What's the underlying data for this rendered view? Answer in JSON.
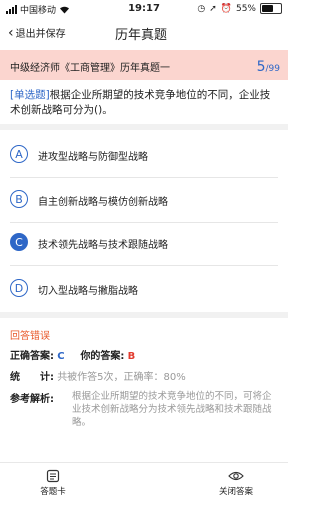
{
  "status": {
    "carrier": "中国移动",
    "time": "19:17",
    "battery": "55%"
  },
  "nav": {
    "back_label": "退出并保存",
    "title": "历年真题"
  },
  "exam": {
    "title": "中级经济师《工商管理》历年真题一",
    "current": "5",
    "total": "/99"
  },
  "question": {
    "type_label": "[单选题]",
    "text": "根据企业所期望的技术竞争地位的不同，企业技术创新战略可分为()。"
  },
  "options": [
    {
      "letter": "A",
      "text": "进攻型战略与防御型战略",
      "selected": false
    },
    {
      "letter": "B",
      "text": "自主创新战略与模仿创新战略",
      "selected": false
    },
    {
      "letter": "C",
      "text": "技术领先战略与技术跟随战略",
      "selected": true
    },
    {
      "letter": "D",
      "text": "切入型战略与撇脂战略",
      "selected": false
    }
  ],
  "result": {
    "title": "回答错误",
    "correct_label": "正确答案:",
    "correct_value": "C",
    "your_label": "你的答案:",
    "your_value": "B",
    "stats_label": "统　　计:",
    "stats_value": "共被作答5次，正确率：80%",
    "analysis_label": "参考解析:",
    "analysis_text": "根据企业所期望的技术竞争地位的不同，可将企业技术创新战略分为技术领先战略和技术跟随战略。"
  },
  "bottom": {
    "answer_card_label": "答题卡",
    "close_answer_label": "关闭答案"
  },
  "colors": {
    "accent": "#2e67c7",
    "header_bg": "#fbd5cf",
    "error": "#e8582a",
    "wrong": "#e23b2e"
  }
}
